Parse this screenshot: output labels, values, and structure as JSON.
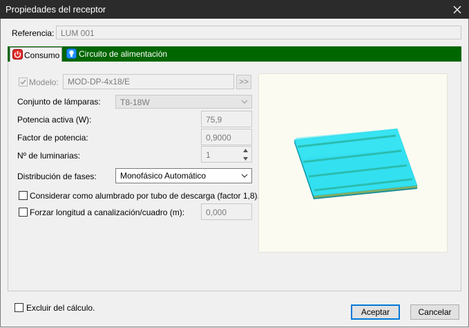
{
  "window": {
    "title": "Propiedades del receptor"
  },
  "referencia": {
    "label": "Referencia:",
    "value": "LUM 001"
  },
  "tabs": [
    {
      "label": "Consumo",
      "icon": "power-icon",
      "active": true
    },
    {
      "label": "Circuito de alimentación",
      "icon": "lamp-icon",
      "active": false
    }
  ],
  "consumo": {
    "modelo": {
      "label": "Modelo:",
      "value": "MOD-DP-4x18/E",
      "checked": true,
      "button": ">>"
    },
    "conjunto": {
      "label": "Conjunto de lámparas:",
      "value": "T8-18W"
    },
    "potencia": {
      "label": "Potencia activa (W):",
      "value": "75,9"
    },
    "factor": {
      "label": "Factor de potencia:",
      "value": "0,9000"
    },
    "luminarias": {
      "label": "Nº de luminarias:",
      "value": "1"
    },
    "distribucion": {
      "label": "Distribución de fases:",
      "value": "Monofásico Automático"
    },
    "descarga": {
      "label": "Considerar como alumbrado por tubo de descarga (factor 1,8).",
      "checked": false
    },
    "forzar": {
      "label": "Forzar longitud a canalización/cuadro (m):",
      "checked": false,
      "value": "0,000"
    }
  },
  "footer": {
    "excluir": {
      "label": "Excluir del cálculo.",
      "checked": false
    },
    "accept_label": "Aceptar",
    "cancel_label": "Cancelar"
  },
  "colors": {
    "tab_bar": "#006600",
    "panel_top": "#33e0f0",
    "accent_button": "#0078d7"
  }
}
